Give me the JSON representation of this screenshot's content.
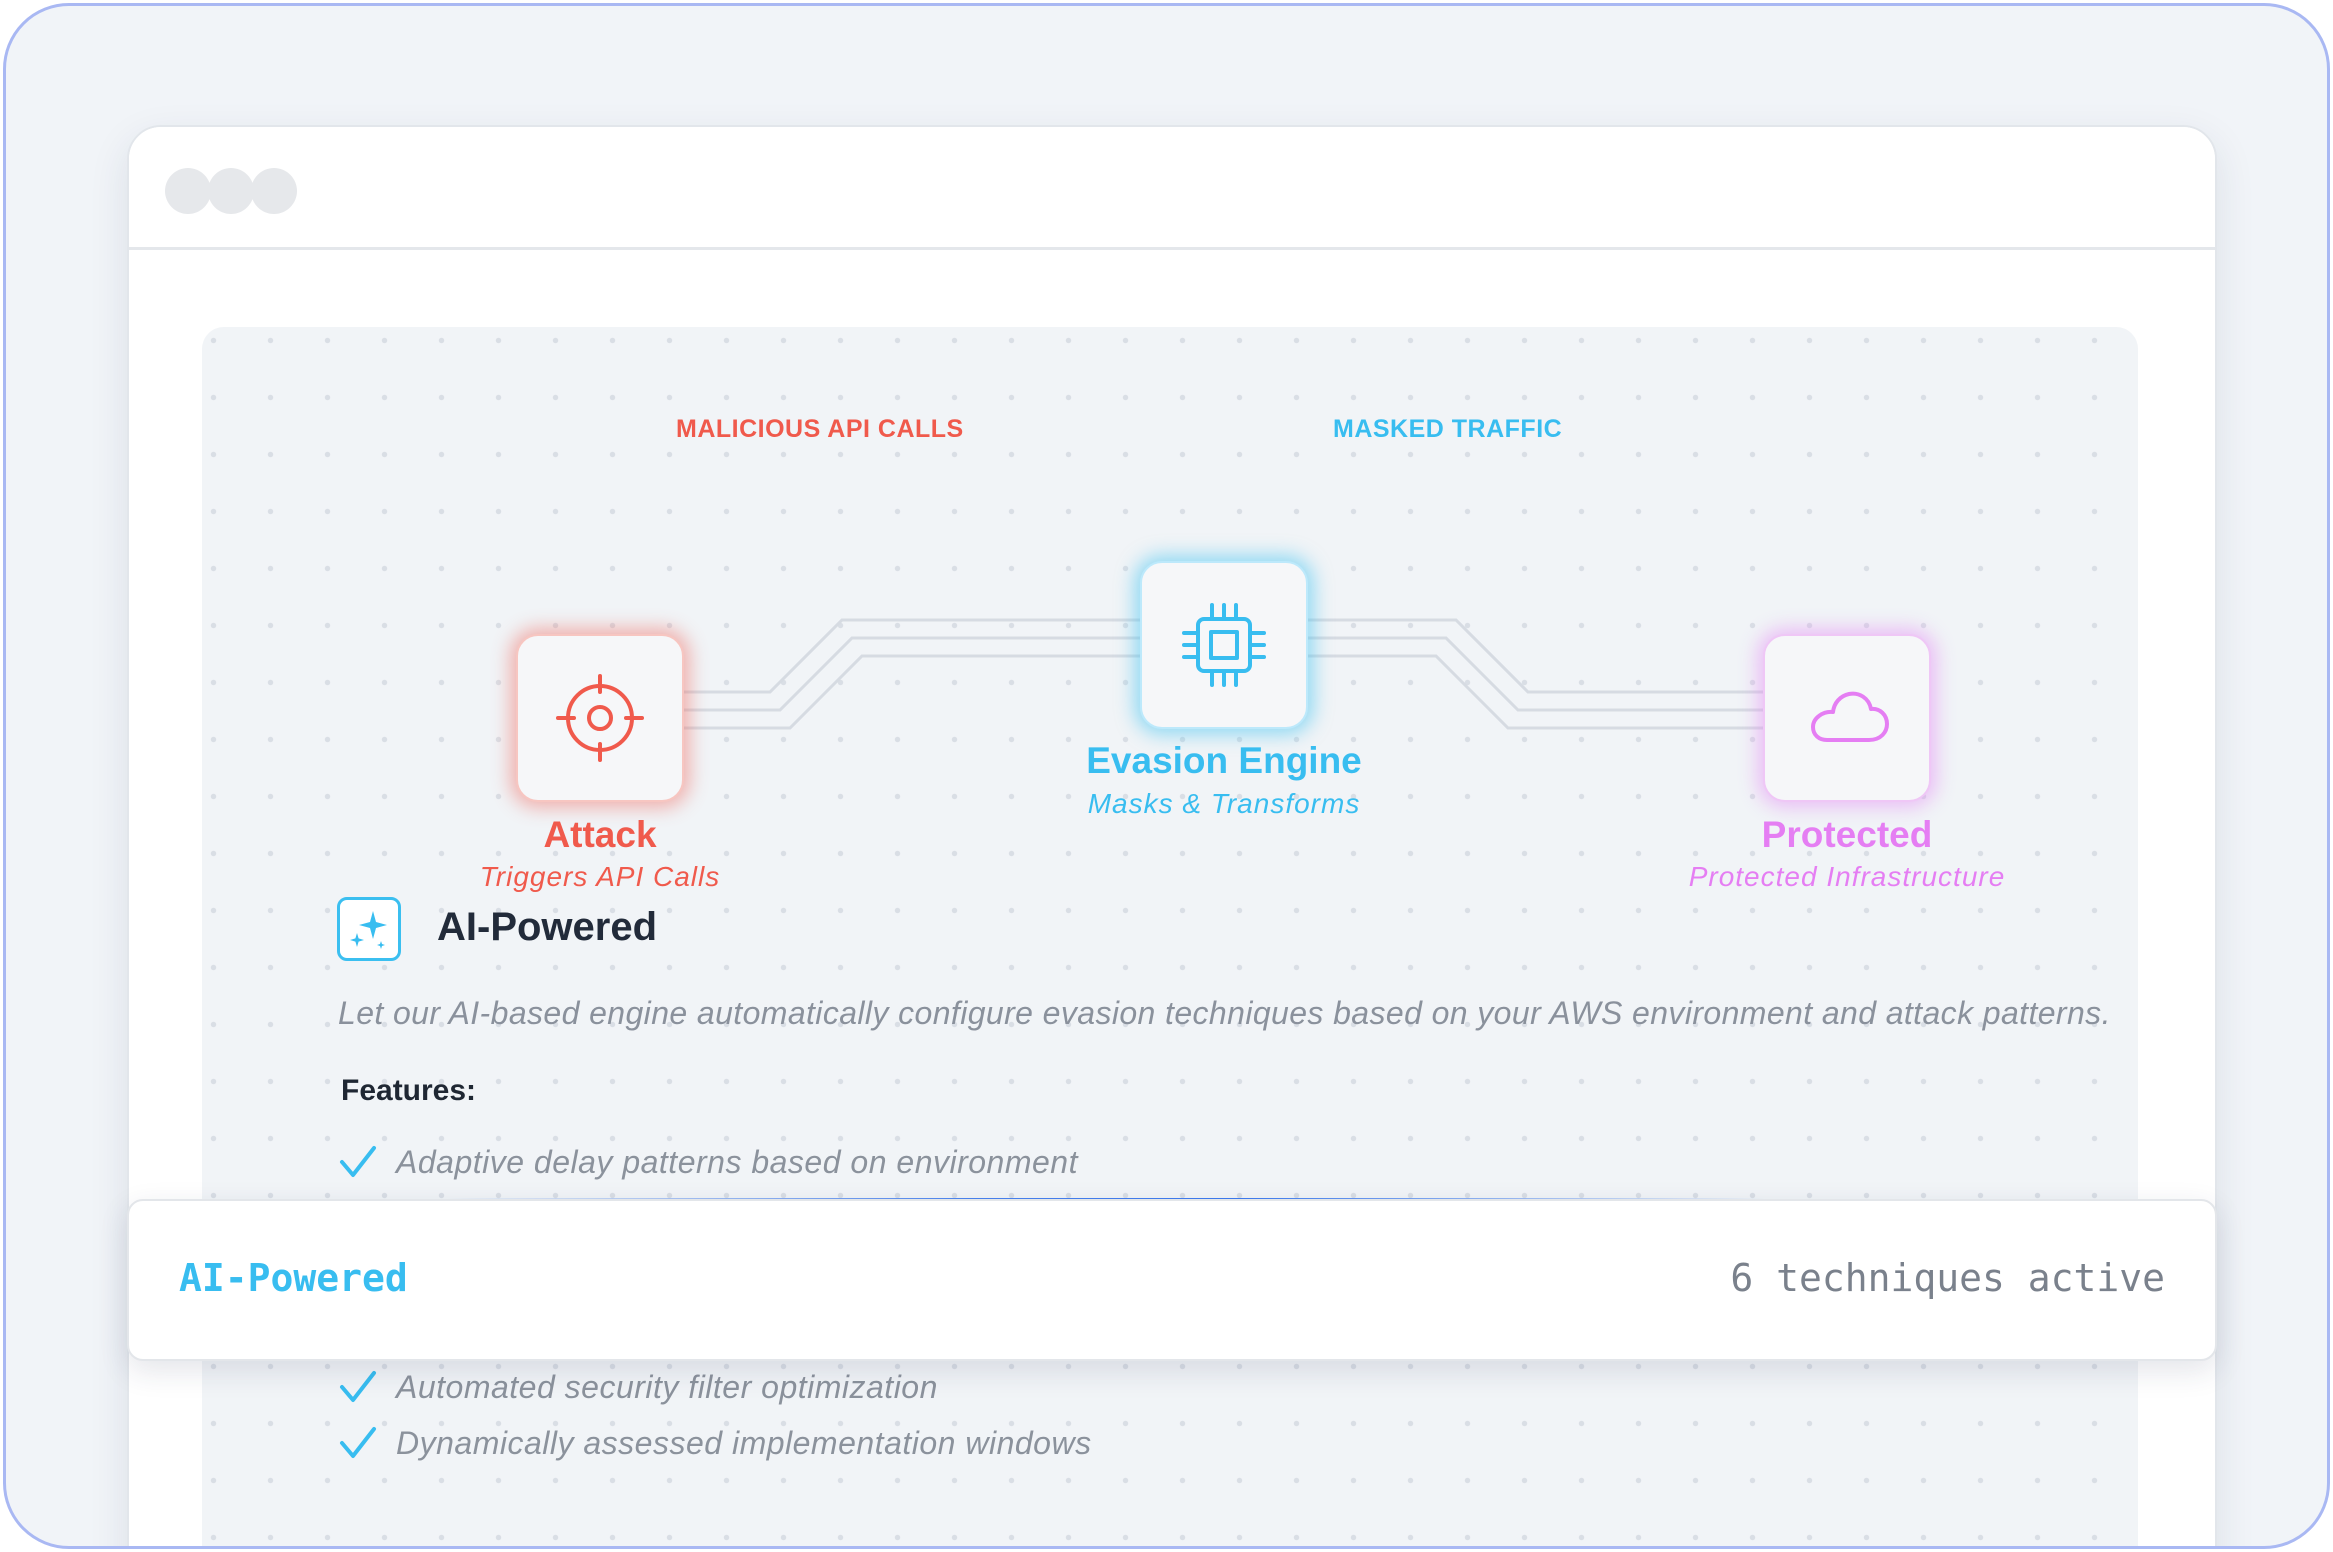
{
  "window": {
    "controls": [
      "window-dot",
      "window-dot",
      "window-dot"
    ]
  },
  "flow": {
    "edge_left_label": "MALICIOUS API CALLS",
    "edge_right_label": "MASKED TRAFFIC",
    "nodes": {
      "attack": {
        "title": "Attack",
        "subtitle": "Triggers API Calls",
        "icon": "crosshair-icon",
        "color": "#f05a4c"
      },
      "engine": {
        "title": "Evasion Engine",
        "subtitle": "Masks & Transforms",
        "icon": "cpu-chip-icon",
        "color": "#38bdf0"
      },
      "protected": {
        "title": "Protected",
        "subtitle": "Protected Infrastructure",
        "icon": "cloud-icon",
        "color": "#e57ef3"
      }
    }
  },
  "section": {
    "icon": "sparkles-icon",
    "title": "AI-Powered",
    "description": "Let our AI-based engine automatically configure evasion techniques based on your AWS environment and attack patterns.",
    "features_heading": "Features:",
    "features": [
      "Adaptive delay patterns based on environment",
      "Automated security filter optimization",
      "Dynamically assessed implementation windows"
    ]
  },
  "statusbar": {
    "mode": "AI-Powered",
    "techniques": "6 techniques active"
  }
}
